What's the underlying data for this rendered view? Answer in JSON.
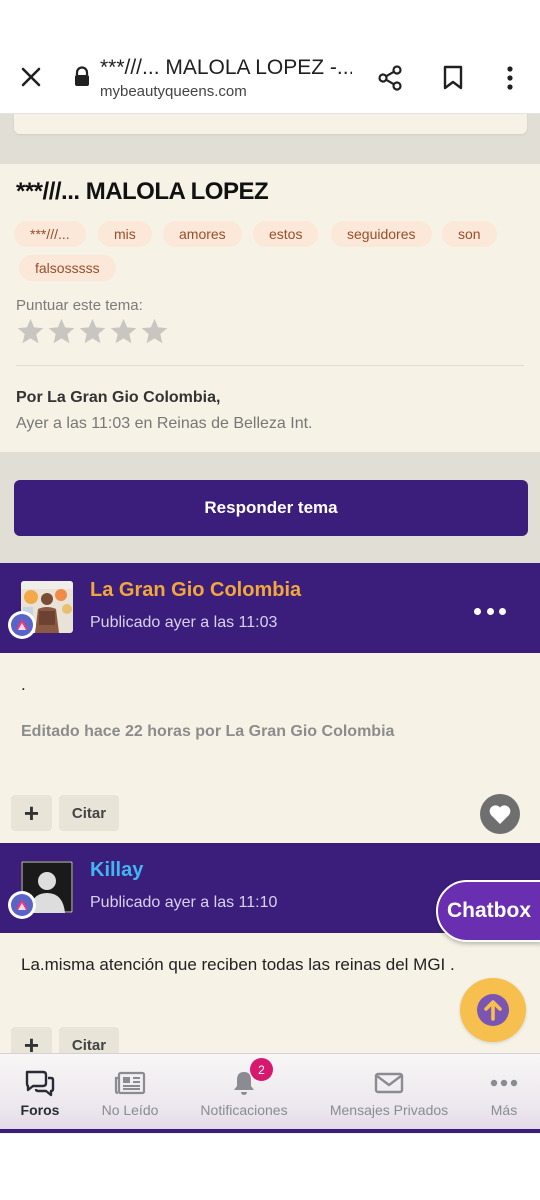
{
  "browser": {
    "title": "***///... MALOLA LOPEZ -...",
    "host": "mybeautyqueens.com"
  },
  "topic": {
    "title": "***///... MALOLA LOPEZ",
    "tags": [
      "***///...",
      "mis",
      "amores",
      "estos",
      "seguidores",
      "son",
      "falsosssss"
    ],
    "rate_label": "Puntuar este tema:",
    "rating": 0,
    "rating_max": 5,
    "author": "Por La Gran Gio Colombia,",
    "dateline": "Ayer a las 11:03 en Reinas de Belleza Int."
  },
  "reply_button": "Responder tema",
  "posts": [
    {
      "author": "La Gran Gio Colombia",
      "author_color": "#f2a73b",
      "time": "Publicado ayer a las 11:03",
      "text": ".",
      "edited": "Editado hace 22 horas por La Gran Gio Colombia",
      "quote_label": "Citar"
    },
    {
      "author": "Killay",
      "author_color": "#41b6f0",
      "time": "Publicado ayer a las 11:10",
      "text": "La.misma atención que reciben todas las reinas del MGI .",
      "quote_label": "Citar"
    }
  ],
  "chatbox_label": "Chatbox",
  "nav": {
    "items": [
      {
        "label": "Foros",
        "icon": "forums-icon",
        "active": true
      },
      {
        "label": "No Leído",
        "icon": "newspaper-icon"
      },
      {
        "label": "Notificaciones",
        "icon": "bell-icon",
        "badge": "2"
      },
      {
        "label": "Mensajes Privados",
        "icon": "envelope-icon"
      },
      {
        "label": "Más",
        "icon": "more-horizontal-icon"
      }
    ]
  },
  "colors": {
    "brand_purple": "#3b1e7c",
    "card_bg": "#f6f2e6",
    "tag_bg": "#fbe8d8",
    "scroll_button": "#f7bf4d",
    "badge": "#d6186f"
  }
}
